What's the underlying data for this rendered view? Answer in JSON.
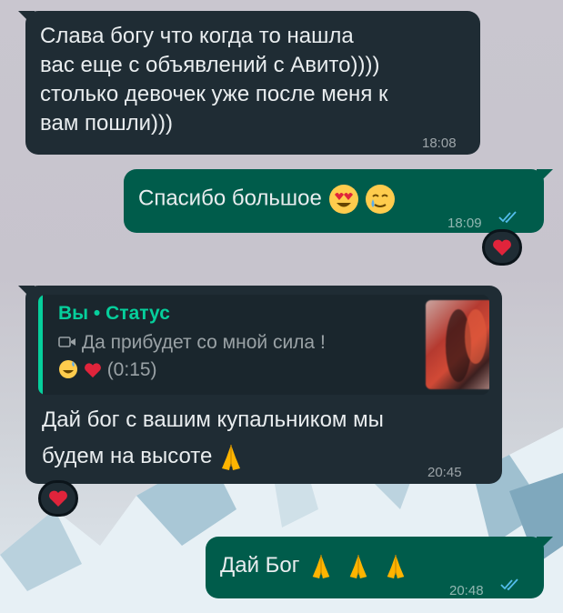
{
  "colors": {
    "incoming_bubble": "#1f2c34",
    "outgoing_bubble": "#005c4b",
    "quote_accent": "#06cf9c",
    "read_ticks": "#53bdeb",
    "text": "#e9edef"
  },
  "messages": [
    {
      "direction": "incoming",
      "lines": [
        "Слава богу что когда то нашла",
        "вас еще с объявлений с Авито))))",
        "столько девочек уже после меня к",
        "вам пошли)))"
      ],
      "time": "18:08"
    },
    {
      "direction": "outgoing",
      "text": "Спасибо большое",
      "emojis": [
        "heart-eyes-emoji",
        "smiling-tear-emoji"
      ],
      "time": "18:09",
      "status": "read",
      "reaction": "red-heart"
    },
    {
      "direction": "incoming",
      "quote": {
        "author": "Вы • Статус",
        "text": "Да прибудет со мной сила !",
        "reactions_suffix": "(0:15)",
        "thumbnail": "blurred-photo"
      },
      "lines": [
        "Дай бог с вашим купальником мы",
        "будем на высоте"
      ],
      "emojis": [
        "folded-hands-emoji"
      ],
      "time": "20:45",
      "reaction": "red-heart"
    },
    {
      "direction": "outgoing",
      "text": "Дай Бог",
      "emojis": [
        "folded-hands-emoji",
        "folded-hands-emoji",
        "folded-hands-emoji"
      ],
      "time": "20:48",
      "status": "read"
    }
  ]
}
